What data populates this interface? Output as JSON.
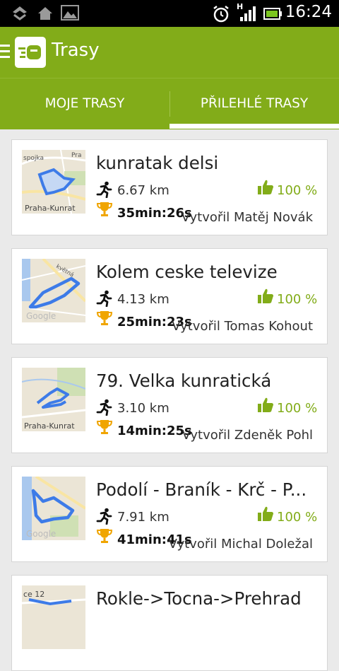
{
  "status_bar": {
    "time": "16:24",
    "network_label": "H"
  },
  "app_bar": {
    "title": "Trasy"
  },
  "tabs": [
    {
      "label": "MOJE TRASY",
      "selected": false
    },
    {
      "label": "PŘILEHLÉ TRASY",
      "selected": true
    }
  ],
  "routes": [
    {
      "title": "kunratak delsi",
      "distance": "6.67 km",
      "time": "35min:26s",
      "rating": "100 %",
      "author": "Vytvořil Matěj Novák",
      "map_labels": [
        "spojka",
        "Praha-Kunrat",
        "Pra"
      ]
    },
    {
      "title": "Kolem ceske televize",
      "distance": "4.13 km",
      "time": "25min:23s",
      "rating": "100 %",
      "author": "Vytvořil Tomas Kohout",
      "map_labels": [
        "Google",
        "květná"
      ]
    },
    {
      "title": "79. Velka kunratická",
      "distance": "3.10 km",
      "time": "14min:25s",
      "rating": "100 %",
      "author": "Vytvořil Zdeněk Pohl",
      "map_labels": [
        "Praha-Kunrat"
      ]
    },
    {
      "title": "Podolí - Braník - Krč - P...",
      "distance": "7.91 km",
      "time": "41min:41s",
      "rating": "100 %",
      "author": "Vytvořil Michal Doležal",
      "map_labels": [
        "Google"
      ]
    },
    {
      "title": "Rokle->Tocna->Prehrad",
      "distance": "",
      "time": "",
      "rating": "",
      "author": "",
      "map_labels": [
        "ce 12"
      ]
    }
  ],
  "colors": {
    "accent": "#82ac19",
    "status_bar": "#000000",
    "route_line": "#3d7be8"
  },
  "icons": {
    "menu": "hamburger-icon",
    "logo": "app-logo-icon",
    "distance": "runner-icon",
    "time": "trophy-icon",
    "rating": "thumbs-up-icon"
  }
}
